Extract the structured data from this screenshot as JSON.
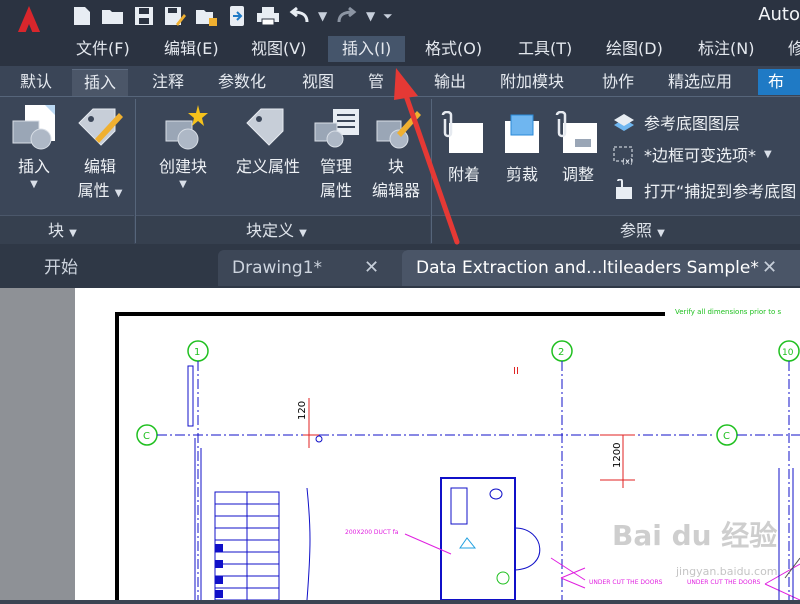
{
  "app": {
    "title": "Auto"
  },
  "menu": {
    "items": [
      "文件(F)",
      "编辑(E)",
      "视图(V)",
      "插入(I)",
      "格式(O)",
      "工具(T)",
      "绘图(D)",
      "标注(N)",
      "修"
    ]
  },
  "ribbon_tabs": [
    "默认",
    "插入",
    "注释",
    "参数化",
    "视图",
    "管",
    "输出",
    "附加模块",
    "协作",
    "精选应用",
    "布局"
  ],
  "panels": {
    "block": {
      "title": "块",
      "insert_label": "插入",
      "edit_attr_label": [
        "编辑",
        "属性"
      ]
    },
    "block_def": {
      "title": "块定义",
      "create_label": "创建块",
      "define_attr_label": "定义属性",
      "manage_attr_label": [
        "管理",
        "属性"
      ],
      "block_editor_label": [
        "块",
        "编辑器"
      ]
    },
    "reference": {
      "title": "参照",
      "attach_label": "附着",
      "clip_label": "剪裁",
      "adjust_label": "调整",
      "underlay_layers": "参考底图图层",
      "frame_variable": "*边框可变选项*",
      "snap_to_underlay": "打开“捕捉到参考底图"
    }
  },
  "doc_tabs": {
    "start": "开始",
    "drawing1": "Drawing1*",
    "current": "Data Extraction and...ltileaders Sample*"
  },
  "drawing": {
    "note_top": "Verify all dimensions prior to s",
    "grid_1": "1",
    "grid_2": "2",
    "grid_10": "10",
    "grid_c": "C",
    "dim_120": "120",
    "dim_1200": "1200",
    "duct_label": "200X200 DUCT fa",
    "under_cut_1": "UNDER CUT THE DOORS",
    "under_cut_2": "UNDER CUT THE DOORS",
    "level_mark": "II"
  },
  "watermark": {
    "text": "Bai du 经验",
    "url": "jingyan.baidu.com"
  },
  "colors": {
    "accent": "#1f7ac5",
    "arrow": "#e53935",
    "cad_blue": "#1010c8",
    "cad_magenta": "#e020e0",
    "cad_green": "#20c020",
    "cad_red": "#e02020"
  }
}
